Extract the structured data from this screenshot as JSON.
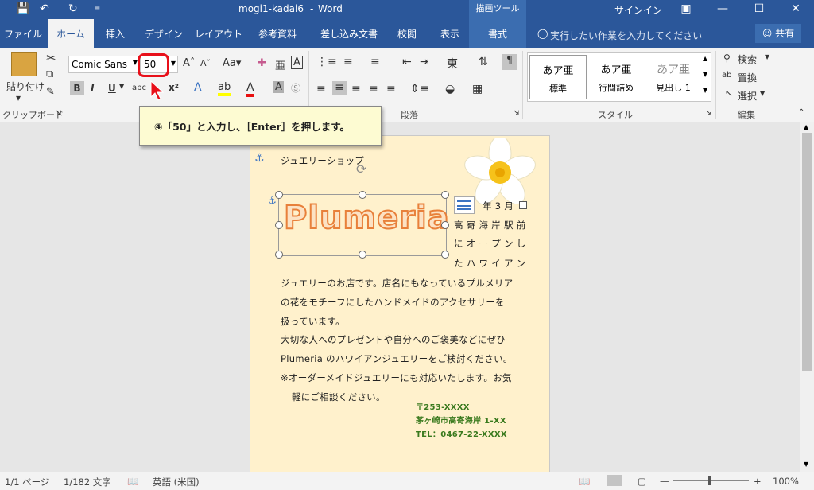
{
  "titlebar": {
    "doc_title": "mogi1-kadai6",
    "sep": "-",
    "app_name": "Word",
    "context_tab": "描画ツール",
    "signin": "サインイン"
  },
  "tabs": [
    "ファイル",
    "ホーム",
    "挿入",
    "デザイン",
    "レイアウト",
    "参考資料",
    "差し込み文書",
    "校閲",
    "表示",
    "書式"
  ],
  "tellme": "実行したい作業を入力してください",
  "share": "共有",
  "ribbon": {
    "paste_label": "貼り付け",
    "clipboard_label": "クリップボード",
    "font_name": "Comic Sans",
    "font_size": "50",
    "paragraph_label": "段落",
    "styles_label": "スタイル",
    "edit_label": "編集",
    "styles": [
      {
        "preview": "あア亜",
        "name": "標準"
      },
      {
        "preview": "あア亜",
        "name": "行間詰め"
      },
      {
        "preview": "あア亜",
        "name": "見出し 1"
      }
    ],
    "search": "検索",
    "replace": "置換",
    "select": "選択"
  },
  "callout": "④「50」と入力し、［Enter］を押します。",
  "document": {
    "heading": "ジュエリーショップ",
    "wordart": "Plumeria",
    "date_fragment": "年 3 月",
    "lines_right": [
      "高 寄 海 岸 駅 前",
      "に オ ー プ ン し",
      "た ハ ワ イ ア ン"
    ],
    "body": [
      "ジュエリーのお店です。店名にもなっているプルメリア",
      "の花をモチーフにしたハンドメイドのアクセサリーを",
      "扱っています。",
      "大切な人へのプレゼントや自分へのご褒美などにぜひ",
      "Plumeria のハワイアンジュエリーをご検討ください。",
      "※オーダーメイドジュエリーにも対応いたします。お気",
      "軽にご相談ください。"
    ],
    "address": [
      "〒253-XXXX",
      "茅ヶ崎市高寄海岸 1-XX",
      "TEL：0467-22-XXXX"
    ]
  },
  "status": {
    "page": "1/1 ページ",
    "words": "1/182 文字",
    "lang": "英語 (米国)",
    "zoom": "100%"
  },
  "colors": {
    "word_blue": "#2b579a",
    "highlight_red": "#e8101a",
    "page": "#fff1cc"
  }
}
